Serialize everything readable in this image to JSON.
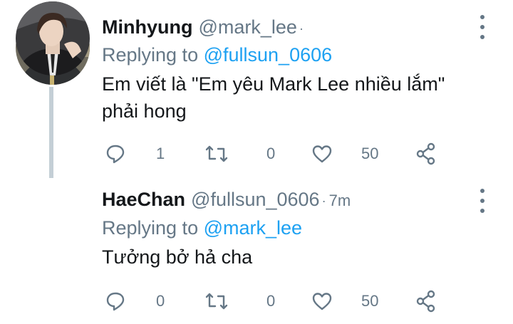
{
  "tweets": [
    {
      "display_name": "Minhyung",
      "handle": "@mark_lee",
      "separator": "·",
      "time": "",
      "replying_prefix": "Replying to ",
      "replying_to": "@fullsun_0606",
      "text_line1": "Em viết là \"Em yêu Mark Lee nhiều lắm\"",
      "text_line2": "phải hong",
      "replies": "1",
      "retweets": "0",
      "likes": "50"
    },
    {
      "display_name": "HaeChan",
      "handle": "@fullsun_0606",
      "separator": "·",
      "time": "7m",
      "replying_prefix": "Replying to ",
      "replying_to": "@mark_lee",
      "text_line1": "Tưởng bở hả cha",
      "text_line2": "",
      "replies": "0",
      "retweets": "0",
      "likes": "50"
    }
  ],
  "icons": {
    "reply": "reply-icon",
    "retweet": "retweet-icon",
    "like": "heart-icon",
    "share": "share-icon",
    "more": "more-vertical-icon"
  },
  "colors": {
    "text": "#14171a",
    "secondary": "#657786",
    "link": "#1da1f2",
    "thread_line": "#c4cfd6"
  }
}
